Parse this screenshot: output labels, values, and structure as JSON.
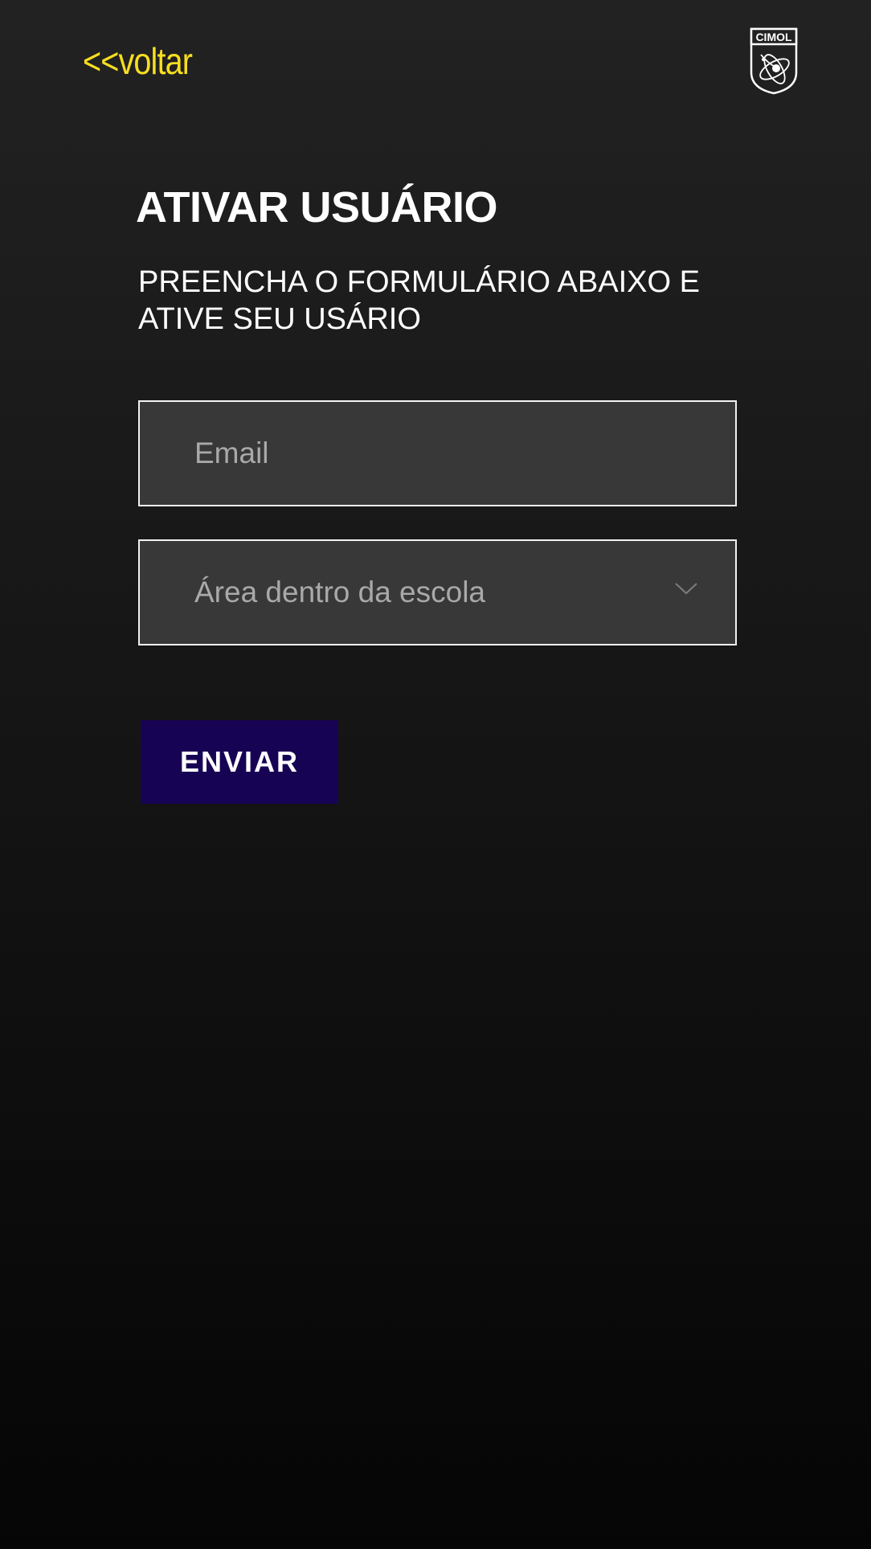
{
  "header": {
    "back_link": "<<voltar",
    "logo": {
      "icon": "cimol-atom-shield-logo",
      "text": "CIMOL"
    }
  },
  "main": {
    "title": "ATIVAR USUÁRIO",
    "subtitle": "PREENCHA O FORMULÁRIO  ABAIXO E\nATIVE SEU USÁRIO",
    "email_field": {
      "placeholder": "Email",
      "value": ""
    },
    "area_select": {
      "placeholder": "Área dentro da escola",
      "icon": "chevron-down-icon"
    },
    "submit_label": "ENVIAR"
  },
  "colors": {
    "background_top": "#222222",
    "background_bottom": "#050505",
    "accent_link": "#f7de21",
    "button": "#170353",
    "field_background": "#383838",
    "placeholder": "#a9a9a9"
  }
}
